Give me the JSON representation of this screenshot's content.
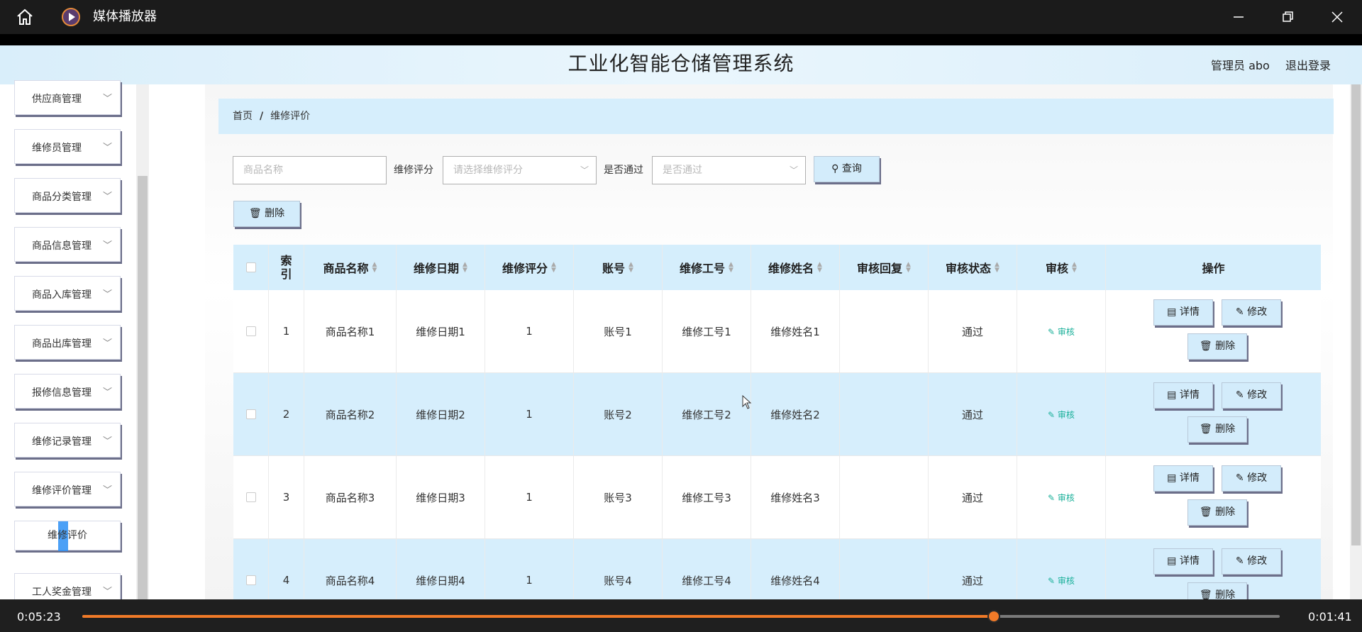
{
  "window": {
    "title": "媒体播放器",
    "controls": [
      "home-icon",
      "minimize-icon",
      "restore-icon",
      "close-icon"
    ]
  },
  "header": {
    "title": "工业化智能仓储管理系统",
    "admin": "管理员 abo",
    "logout": "退出登录"
  },
  "sidebar": {
    "items": [
      {
        "label": "供应商管理",
        "icon": "chevron-down-icon"
      },
      {
        "label": "维修员管理",
        "icon": "chevron-down-icon"
      },
      {
        "label": "商品分类管理",
        "icon": "chevron-down-icon"
      },
      {
        "label": "商品信息管理",
        "icon": "chevron-down-icon"
      },
      {
        "label": "商品入库管理",
        "icon": "chevron-down-icon"
      },
      {
        "label": "商品出库管理",
        "icon": "chevron-down-icon"
      },
      {
        "label": "报修信息管理",
        "icon": "chevron-down-icon"
      },
      {
        "label": "维修记录管理",
        "icon": "chevron-down-icon"
      },
      {
        "label": "维修评价管理",
        "icon": "chevron-down-icon"
      }
    ],
    "submenu_item": "维修评价",
    "item_after": {
      "label": "工人奖金管理",
      "icon": "chevron-down-icon"
    }
  },
  "breadcrumb": {
    "home": "首页",
    "separator": "/",
    "current": "维修评价"
  },
  "filters": {
    "name_placeholder": "商品名称",
    "rating_label": "维修评分",
    "rating_placeholder": "请选择维修评分",
    "pass_label": "是否通过",
    "pass_placeholder": "是否通过",
    "search_button": "查询",
    "delete_button": "删除"
  },
  "table": {
    "columns": [
      "索引",
      "商品名称",
      "维修日期",
      "维修评分",
      "账号",
      "维修工号",
      "维修姓名",
      "审核回复",
      "审核状态",
      "审核",
      "操作"
    ],
    "audit_link": "审核",
    "actions": {
      "detail": "详情",
      "edit": "修改",
      "delete": "删除"
    },
    "rows": [
      {
        "index": "1",
        "name": "商品名称1",
        "date": "维修日期1",
        "score": "1",
        "account": "账号1",
        "worker_id": "维修工号1",
        "worker_name": "维修姓名1",
        "reply": "",
        "status": "通过"
      },
      {
        "index": "2",
        "name": "商品名称2",
        "date": "维修日期2",
        "score": "1",
        "account": "账号2",
        "worker_id": "维修工号2",
        "worker_name": "维修姓名2",
        "reply": "",
        "status": "通过"
      },
      {
        "index": "3",
        "name": "商品名称3",
        "date": "维修日期3",
        "score": "1",
        "account": "账号3",
        "worker_id": "维修工号3",
        "worker_name": "维修姓名3",
        "reply": "",
        "status": "通过"
      },
      {
        "index": "4",
        "name": "商品名称4",
        "date": "维修日期4",
        "score": "1",
        "account": "账号4",
        "worker_id": "维修工号4",
        "worker_name": "维修姓名4",
        "reply": "",
        "status": "通过"
      }
    ]
  },
  "player": {
    "elapsed": "0:05:23",
    "remaining": "0:01:41",
    "progress": 0.7615,
    "accent": "#f07a28"
  }
}
